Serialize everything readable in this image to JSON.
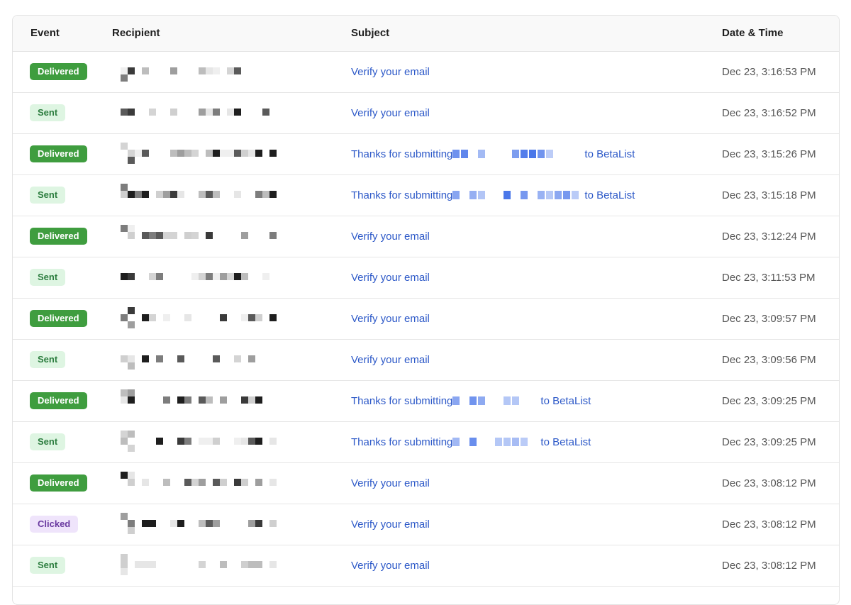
{
  "table": {
    "headers": {
      "event": "Event",
      "recipient": "Recipient",
      "subject": "Subject",
      "datetime": "Date & Time"
    },
    "rows": [
      {
        "event": "Delivered",
        "event_type": "delivered",
        "subject": "Verify your email",
        "datetime": "Dec 23, 3:16:53 PM"
      },
      {
        "event": "Sent",
        "event_type": "sent",
        "subject": "Verify your email",
        "datetime": "Dec 23, 3:16:52 PM"
      },
      {
        "event": "Delivered",
        "event_type": "delivered",
        "subject_prefix": "Thanks for submitting",
        "subject_suffix": "to BetaList",
        "datetime": "Dec 23, 3:15:26 PM"
      },
      {
        "event": "Sent",
        "event_type": "sent",
        "subject_prefix": "Thanks for submitting",
        "subject_suffix": "to BetaList",
        "datetime": "Dec 23, 3:15:18 PM"
      },
      {
        "event": "Delivered",
        "event_type": "delivered",
        "subject": "Verify your email",
        "datetime": "Dec 23, 3:12:24 PM"
      },
      {
        "event": "Sent",
        "event_type": "sent",
        "subject": "Verify your email",
        "datetime": "Dec 23, 3:11:53 PM"
      },
      {
        "event": "Delivered",
        "event_type": "delivered",
        "subject": "Verify your email",
        "datetime": "Dec 23, 3:09:57 PM"
      },
      {
        "event": "Sent",
        "event_type": "sent",
        "subject": "Verify your email",
        "datetime": "Dec 23, 3:09:56 PM"
      },
      {
        "event": "Delivered",
        "event_type": "delivered",
        "subject_prefix": "Thanks for submitting",
        "subject_suffix": "to BetaList",
        "datetime": "Dec 23, 3:09:25 PM"
      },
      {
        "event": "Sent",
        "event_type": "sent",
        "subject_prefix": "Thanks for submitting",
        "subject_suffix": "to BetaList",
        "datetime": "Dec 23, 3:09:25 PM"
      },
      {
        "event": "Delivered",
        "event_type": "delivered",
        "subject": "Verify your email",
        "datetime": "Dec 23, 3:08:12 PM"
      },
      {
        "event": "Clicked",
        "event_type": "clicked",
        "subject": "Verify your email",
        "datetime": "Dec 23, 3:08:12 PM"
      },
      {
        "event": "Sent",
        "event_type": "sent",
        "subject": "Verify your email",
        "datetime": "Dec 23, 3:08:12 PM"
      }
    ]
  },
  "colors": {
    "delivered_badge": "#3f9d3f",
    "sent_badge_bg": "#def5e2",
    "clicked_badge_bg": "#efe4fb",
    "link": "#2d59c8",
    "redaction_blue": "#3f6ee8"
  }
}
